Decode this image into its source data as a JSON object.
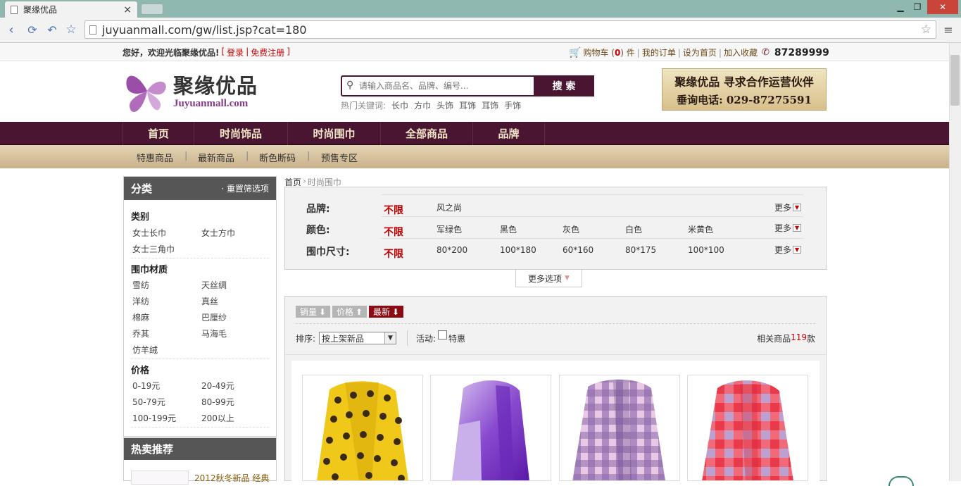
{
  "browser": {
    "tab_title": "聚缘优品",
    "tab_close": "×",
    "url": "juyuanmall.com/gw/list.jsp?cat=180"
  },
  "topbar": {
    "welcome": "您好，欢迎光临聚缘优品!",
    "bracket_open": "[",
    "login": "登录",
    "pipe": "|",
    "register": "免费注册",
    "bracket_close": "]",
    "cart_label": "购物车 (",
    "cart_count": "0",
    "cart_suffix": ") 件",
    "orders": "我的订单",
    "set_home": "设为首页",
    "favorite": "加入收藏",
    "phone": "87289999"
  },
  "header": {
    "logo_cn": "聚缘优品",
    "logo_en": "Juyuanmall.com",
    "search_placeholder": "请输入商品名、品牌、编号...",
    "search_button": "搜 索",
    "hot_label": "热门关键词:",
    "hot_keywords": [
      "长巾",
      "方巾",
      "头饰",
      "耳饰",
      "耳饰",
      "手饰"
    ],
    "banner_line1": "聚缘优品 寻求合作运营伙伴",
    "banner_line2": "垂询电话: 029-87275591"
  },
  "mainnav": [
    "首页",
    "时尚饰品",
    "时尚围巾",
    "全部商品",
    "品牌"
  ],
  "subnav": [
    "特惠商品",
    "最新商品",
    "断色断码",
    "预售专区"
  ],
  "sidebar": {
    "title": "分类",
    "reset": "· 重置筛选项",
    "groups": [
      {
        "title": "类别",
        "options": [
          "女士长巾",
          "女士方巾",
          "女士三角巾"
        ]
      },
      {
        "title": "围巾材质",
        "options": [
          "雪纺",
          "天丝绸",
          "洋纺",
          "真丝",
          "棉麻",
          "巴厘纱",
          "乔其",
          "马海毛",
          "仿羊绒"
        ]
      },
      {
        "title": "价格",
        "options": [
          "0-19元",
          "20-49元",
          "50-79元",
          "80-99元",
          "100-199元",
          "200以上"
        ]
      }
    ],
    "hot_title": "热卖推荐",
    "hot_item": "2012秋冬新品 经典"
  },
  "breadcrumb": {
    "home": "首页",
    "sep": "›",
    "current": "时尚围巾"
  },
  "filters": [
    {
      "label": "品牌:",
      "none": "不限",
      "values": [
        "风之尚"
      ],
      "more": "更多"
    },
    {
      "label": "颜色:",
      "none": "不限",
      "values": [
        "军绿色",
        "黑色",
        "灰色",
        "白色",
        "米黄色"
      ],
      "more": "更多"
    },
    {
      "label": "围巾尺寸:",
      "none": "不限",
      "values": [
        "80*200",
        "100*180",
        "60*160",
        "80*175",
        "100*100"
      ],
      "more": "更多"
    }
  ],
  "more_options": "更多选项",
  "sortbar": {
    "tabs": [
      "销量",
      "价格",
      "最新"
    ],
    "sort_label": "排序:",
    "sort_value": "按上架新品",
    "activity_label": "活动:",
    "activity_option": "特惠",
    "result_prefix": "相关商品",
    "result_count": "119",
    "result_suffix": "款"
  },
  "products": [
    {
      "name": "yellow-polka-dot-scarf"
    },
    {
      "name": "purple-gradient-scarf"
    },
    {
      "name": "lavender-plaid-scarf"
    },
    {
      "name": "pink-red-check-scarf"
    }
  ],
  "colors": {
    "nav_bg": "#4a1530",
    "accent_red": "#c00000",
    "sidebar_head": "#565656",
    "sort_active": "#8b0a14"
  }
}
